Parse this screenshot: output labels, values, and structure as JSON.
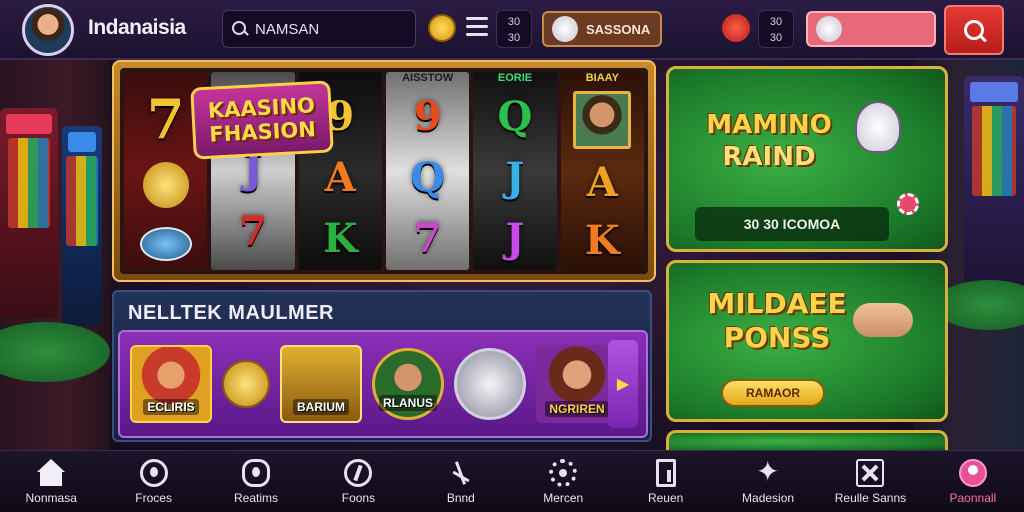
{
  "header": {
    "app_title": "Indanaisia",
    "search_value": "NAMSAN",
    "counter_1": [
      "30",
      "30"
    ],
    "counter_2": [
      "30",
      "30"
    ],
    "promo_pill": "SASSONA",
    "profile_pill": "",
    "colors": {
      "accent": "#e53a35",
      "bar": "#2b1c44"
    }
  },
  "slot": {
    "badge_line1": "KAASINO",
    "badge_line2": "FHASION",
    "reels": [
      {
        "head": "",
        "symbols": [
          "7",
          "gold-orb",
          "shield-icon"
        ]
      },
      {
        "head": "",
        "symbols": [
          "J",
          "7"
        ]
      },
      {
        "head": "",
        "symbols": [
          "9",
          "A",
          "K"
        ]
      },
      {
        "head": "AISSTOW",
        "symbols": [
          "9",
          "Q",
          "7"
        ]
      },
      {
        "head": "EORIE",
        "symbols": [
          "Q",
          "J",
          "J"
        ]
      },
      {
        "head": "BIAAY",
        "symbols": [
          "portrait",
          "A",
          "K"
        ]
      }
    ]
  },
  "jackpot": {
    "title": "NELLTEK MAULMER",
    "tiles": [
      {
        "label": "ECLIRIS"
      },
      {
        "label": ""
      },
      {
        "label": "BARIUM"
      },
      {
        "label": "RLANUS"
      },
      {
        "label": ""
      },
      {
        "label": "NGRIREN"
      }
    ]
  },
  "promos": [
    {
      "title_line1": "MAMINO",
      "title_line2": "RAIND",
      "bar_text": "30 30 ICOMOA"
    },
    {
      "title_line1": "MILDAEE",
      "title_line2": "PONSS",
      "button_text": "RAMAOR"
    }
  ],
  "nav": [
    {
      "label": "Nonmasa",
      "icon": "home-icon"
    },
    {
      "label": "Froces",
      "icon": "user-icon"
    },
    {
      "label": "Reatims",
      "icon": "controller-icon"
    },
    {
      "label": "Foons",
      "icon": "bolt-icon"
    },
    {
      "label": "Bnnd",
      "icon": "lightning-icon"
    },
    {
      "label": "Mercen",
      "icon": "gear-icon"
    },
    {
      "label": "Reuen",
      "icon": "door-icon"
    },
    {
      "label": "Madesion",
      "icon": "star-icon"
    },
    {
      "label": "Reulle Sanns",
      "icon": "cross-icon"
    },
    {
      "label": "Paonnall",
      "icon": "profile-icon"
    }
  ]
}
